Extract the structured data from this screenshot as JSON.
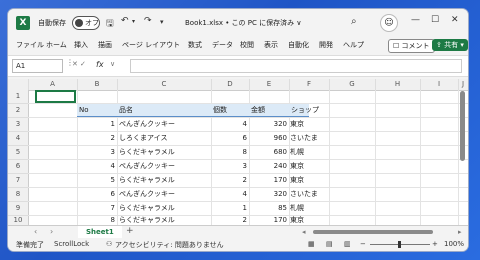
{
  "title_bar": {
    "autosave_label": "自動保存",
    "autosave_state": "オフ",
    "document_title": "Book1.xlsx • この PC に保存済み ∨",
    "icons": [
      "excel-logo",
      "save-icon",
      "undo-icon",
      "redo-icon",
      "customize-icon",
      "search-icon",
      "avatar",
      "minimize-icon",
      "maximize-icon",
      "close-icon"
    ]
  },
  "menu": {
    "items": [
      "ファイル",
      "ホーム",
      "挿入",
      "描画",
      "ページ レイアウト",
      "数式",
      "データ",
      "校閲",
      "表示",
      "自動化",
      "開発",
      "ヘルプ"
    ],
    "comment_label": "コメント",
    "share_label": "共有"
  },
  "formula_bar": {
    "name_box": "A1",
    "fx_label": "fx",
    "value": ""
  },
  "columns": [
    "A",
    "B",
    "C",
    "D",
    "E",
    "F",
    "G",
    "H",
    "I",
    "J"
  ],
  "rows": [
    "1",
    "2",
    "3",
    "4",
    "5",
    "6",
    "7",
    "8",
    "9",
    "10"
  ],
  "table": {
    "headers": {
      "no": "No",
      "name": "品名",
      "qty": "個数",
      "amount": "金額",
      "shop": "ショップ"
    },
    "data": [
      {
        "no": "1",
        "name": "ぺんぎんクッキー",
        "qty": "4",
        "amount": "320",
        "shop": "東京"
      },
      {
        "no": "2",
        "name": "しろくまアイス",
        "qty": "6",
        "amount": "960",
        "shop": "さいたま"
      },
      {
        "no": "3",
        "name": "らくだキャラメル",
        "qty": "8",
        "amount": "680",
        "shop": "札幌"
      },
      {
        "no": "4",
        "name": "ぺんぎんクッキー",
        "qty": "3",
        "amount": "240",
        "shop": "東京"
      },
      {
        "no": "5",
        "name": "らくだキャラメル",
        "qty": "2",
        "amount": "170",
        "shop": "東京"
      },
      {
        "no": "6",
        "name": "ぺんぎんクッキー",
        "qty": "4",
        "amount": "320",
        "shop": "さいたま"
      },
      {
        "no": "7",
        "name": "らくだキャラメル",
        "qty": "1",
        "amount": "85",
        "shop": "札幌"
      },
      {
        "no": "8",
        "name": "らくだキャラメル",
        "qty": "2",
        "amount": "170",
        "shop": "東京"
      }
    ]
  },
  "sheet_tabs": {
    "active": "Sheet1",
    "add": "+"
  },
  "status_bar": {
    "ready": "準備完了",
    "scroll_lock": "ScrollLock",
    "accessibility": "アクセシビリティ: 問題ありません",
    "zoom": "100%"
  },
  "colors": {
    "accent": "#1d7a45",
    "header_fill": "#dceaf7"
  }
}
